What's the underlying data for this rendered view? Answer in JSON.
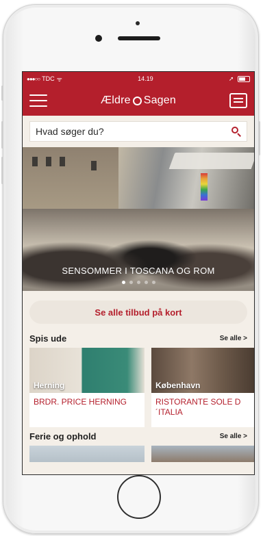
{
  "status_bar": {
    "carrier": "TDC",
    "time": "14.19"
  },
  "app_bar": {
    "logo_part1": "Ældre",
    "logo_part2": "Sagen",
    "menu_icon": "hamburger-icon",
    "messages_icon": "messages-icon"
  },
  "search": {
    "placeholder": "Hvad søger du?",
    "icon": "search-icon"
  },
  "hero": {
    "caption": "SENSOMMER I TOSCANA OG ROM",
    "pages": 5,
    "active_page": 1
  },
  "cta": {
    "label": "Se alle tilbud på kort"
  },
  "sections": [
    {
      "title": "Spis ude",
      "see_all": "Se alle >",
      "cards": [
        {
          "place": "Herning",
          "name": "BRDR. PRICE HERNING"
        },
        {
          "place": "København",
          "name": "RISTORANTE SOLE D´ITALIA"
        }
      ]
    },
    {
      "title": "Ferie og ophold",
      "see_all": "Se alle >"
    }
  ],
  "colors": {
    "brand_red": "#b41f2c",
    "background": "#f4efe8"
  }
}
